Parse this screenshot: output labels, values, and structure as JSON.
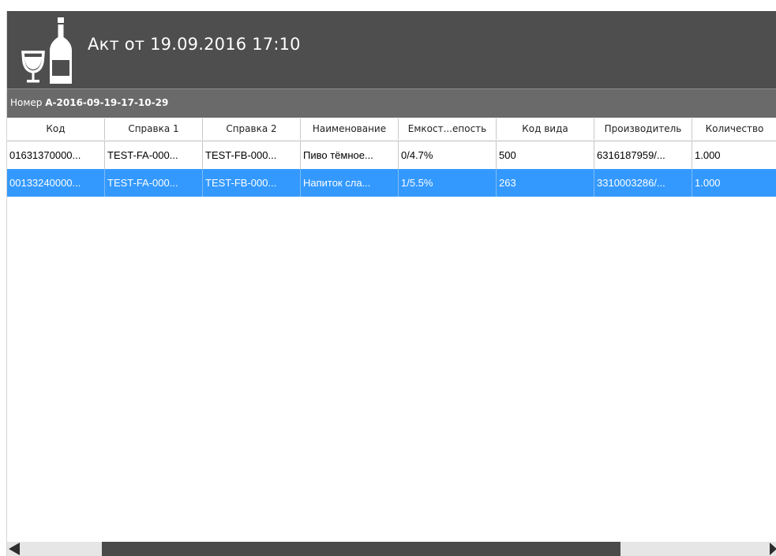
{
  "header": {
    "title": "Акт от 19.09.2016 17:10",
    "logo_icon": "wine-glass-and-bottle-icon"
  },
  "subheader": {
    "label": "Номер",
    "value": "А-2016-09-19-17-10-29"
  },
  "table": {
    "columns": [
      "Код",
      "Справка 1",
      "Справка 2",
      "Наименование",
      "Емкост...епость",
      "Код вида",
      "Производитель",
      "Количество"
    ],
    "rows": [
      [
        "01631370000...",
        "TEST-FA-000...",
        "TEST-FB-000...",
        "Пиво тёмное...",
        "0/4.7%",
        "500",
        "6316187959/...",
        "1.000"
      ],
      [
        "00133240000...",
        "TEST-FA-000...",
        "TEST-FB-000...",
        "Напиток сла...",
        "1/5.5%",
        "263",
        "3310003286/...",
        "1.000"
      ]
    ],
    "selected_row_index": 1
  },
  "scrollbar": {
    "left_icon": "arrow-left-icon",
    "right_icon": "arrow-right-icon"
  },
  "colors": {
    "header_bg": "#4e4e4e",
    "subheader_bg": "#6a6a6a",
    "selection": "#3399ff"
  }
}
